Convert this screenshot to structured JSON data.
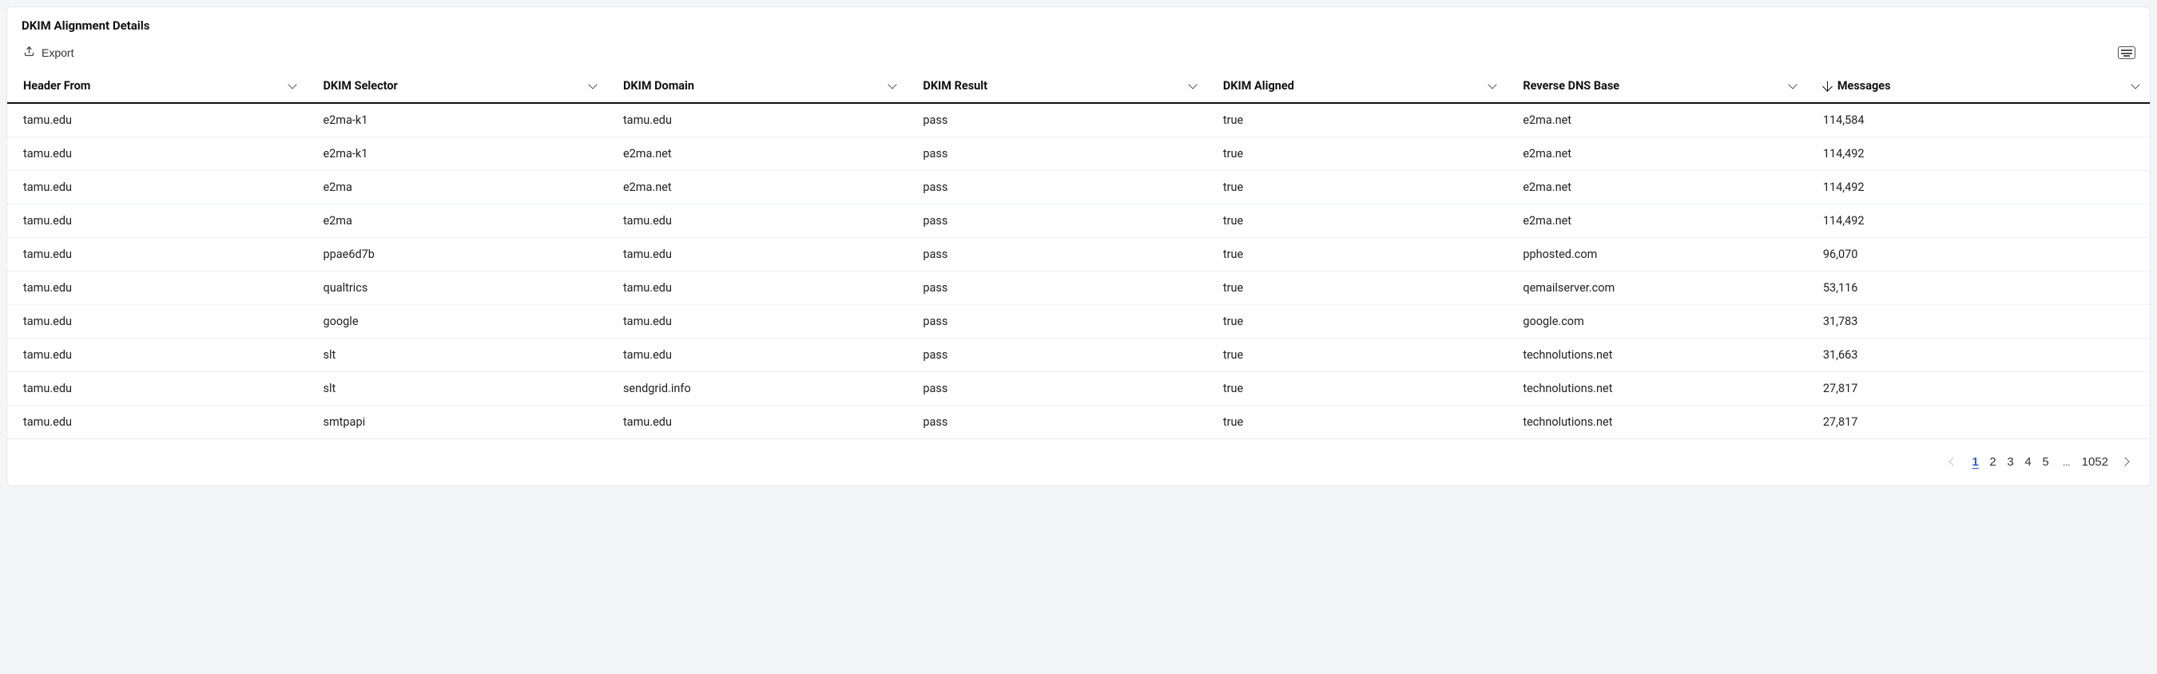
{
  "panel": {
    "title": "DKIM Alignment Details"
  },
  "toolbar": {
    "export_label": "Export"
  },
  "table": {
    "columns": [
      {
        "label": "Header From",
        "sorted": false
      },
      {
        "label": "DKIM Selector",
        "sorted": false
      },
      {
        "label": "DKIM Domain",
        "sorted": false
      },
      {
        "label": "DKIM Result",
        "sorted": false
      },
      {
        "label": "DKIM Aligned",
        "sorted": false
      },
      {
        "label": "Reverse DNS Base",
        "sorted": false
      },
      {
        "label": "Messages",
        "sorted": true,
        "sort_dir": "desc"
      }
    ],
    "rows": [
      {
        "header_from": "tamu.edu",
        "dkim_selector": "e2ma-k1",
        "dkim_domain": "tamu.edu",
        "dkim_result": "pass",
        "dkim_aligned": "true",
        "reverse_dns_base": "e2ma.net",
        "messages": "114,584"
      },
      {
        "header_from": "tamu.edu",
        "dkim_selector": "e2ma-k1",
        "dkim_domain": "e2ma.net",
        "dkim_result": "pass",
        "dkim_aligned": "true",
        "reverse_dns_base": "e2ma.net",
        "messages": "114,492"
      },
      {
        "header_from": "tamu.edu",
        "dkim_selector": "e2ma",
        "dkim_domain": "e2ma.net",
        "dkim_result": "pass",
        "dkim_aligned": "true",
        "reverse_dns_base": "e2ma.net",
        "messages": "114,492"
      },
      {
        "header_from": "tamu.edu",
        "dkim_selector": "e2ma",
        "dkim_domain": "tamu.edu",
        "dkim_result": "pass",
        "dkim_aligned": "true",
        "reverse_dns_base": "e2ma.net",
        "messages": "114,492"
      },
      {
        "header_from": "tamu.edu",
        "dkim_selector": "ppae6d7b",
        "dkim_domain": "tamu.edu",
        "dkim_result": "pass",
        "dkim_aligned": "true",
        "reverse_dns_base": "pphosted.com",
        "messages": "96,070"
      },
      {
        "header_from": "tamu.edu",
        "dkim_selector": "qualtrics",
        "dkim_domain": "tamu.edu",
        "dkim_result": "pass",
        "dkim_aligned": "true",
        "reverse_dns_base": "qemailserver.com",
        "messages": "53,116"
      },
      {
        "header_from": "tamu.edu",
        "dkim_selector": "google",
        "dkim_domain": "tamu.edu",
        "dkim_result": "pass",
        "dkim_aligned": "true",
        "reverse_dns_base": "google.com",
        "messages": "31,783"
      },
      {
        "header_from": "tamu.edu",
        "dkim_selector": "slt",
        "dkim_domain": "tamu.edu",
        "dkim_result": "pass",
        "dkim_aligned": "true",
        "reverse_dns_base": "technolutions.net",
        "messages": "31,663"
      },
      {
        "header_from": "tamu.edu",
        "dkim_selector": "slt",
        "dkim_domain": "sendgrid.info",
        "dkim_result": "pass",
        "dkim_aligned": "true",
        "reverse_dns_base": "technolutions.net",
        "messages": "27,817"
      },
      {
        "header_from": "tamu.edu",
        "dkim_selector": "smtpapi",
        "dkim_domain": "tamu.edu",
        "dkim_result": "pass",
        "dkim_aligned": "true",
        "reverse_dns_base": "technolutions.net",
        "messages": "27,817"
      }
    ]
  },
  "pagination": {
    "pages_shown": [
      "1",
      "2",
      "3",
      "4",
      "5"
    ],
    "ellipsis": "…",
    "last_page": "1052",
    "current_page": "1",
    "prev_disabled": true,
    "next_disabled": false
  }
}
